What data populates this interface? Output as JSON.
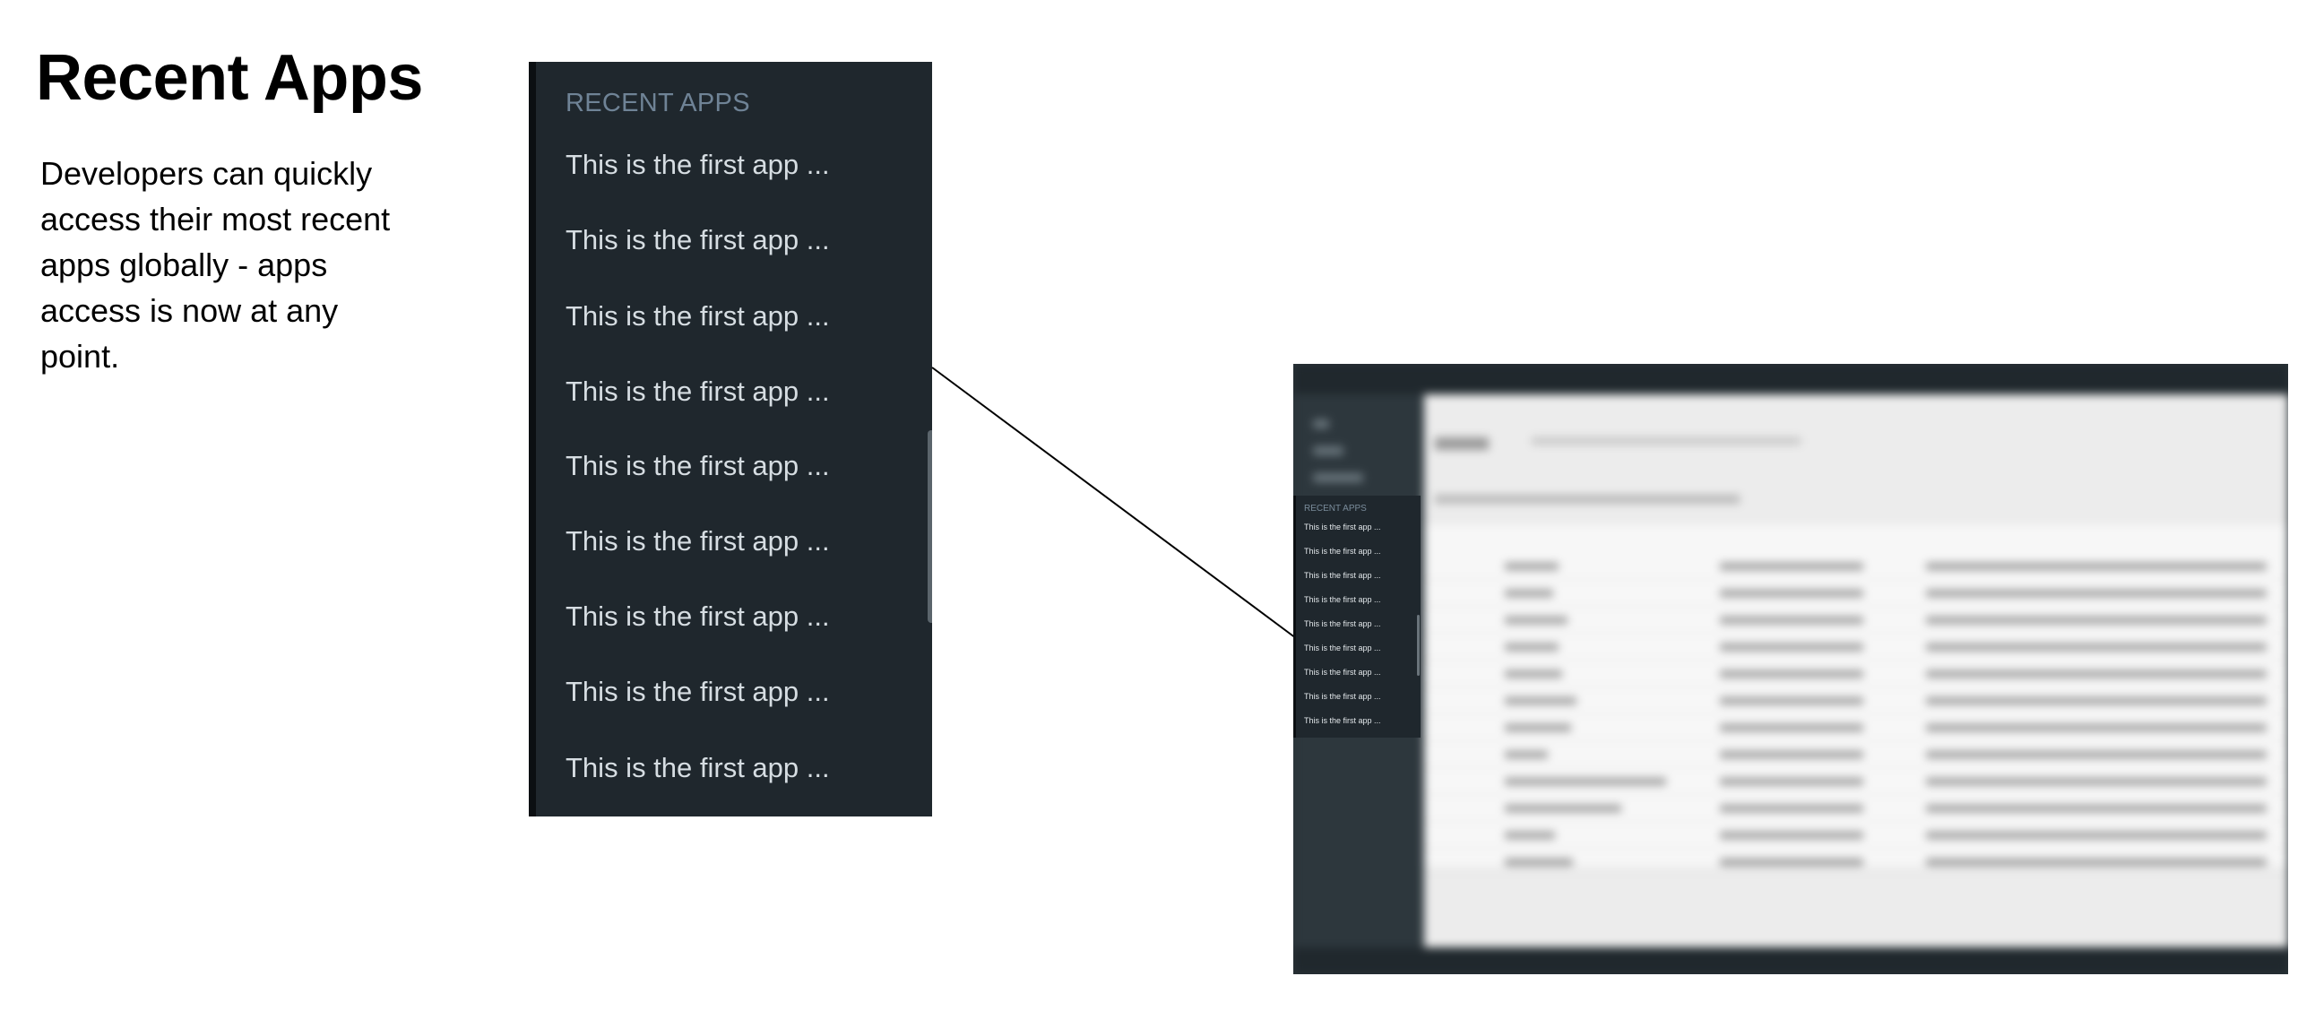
{
  "title": "Recent Apps",
  "description": "Developers can quickly access their most recent apps globally - apps access is now at any point.",
  "recent_apps_panel": {
    "heading": "RECENT APPS",
    "items": [
      "This is the first app ...",
      "This is the first app ...",
      "This is the first app ...",
      "This is the first app ...",
      "This is the first app ...",
      "This is the first app ...",
      "This is the first app ...",
      "This is the first app ...",
      "This is the first app ..."
    ]
  },
  "colors": {
    "panel_bg": "#1f272d",
    "panel_heading": "#6f8396",
    "panel_item_text": "#d6dde2",
    "accent_button": "#3d7fc0"
  }
}
